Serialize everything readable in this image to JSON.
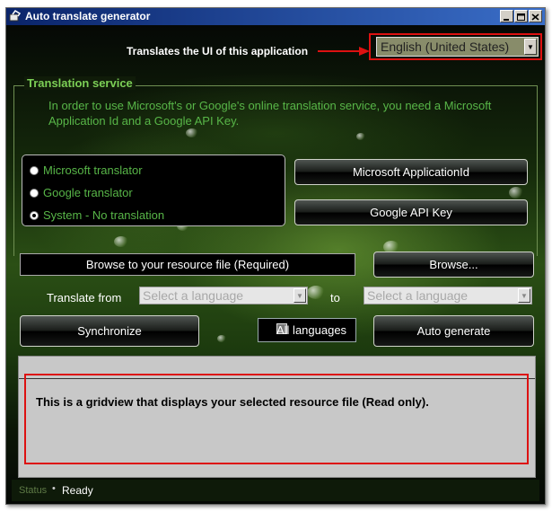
{
  "window": {
    "title": "Auto translate generator"
  },
  "ui_language": {
    "caption": "Translates the UI of this application",
    "selected": "English (United States)"
  },
  "translation_service": {
    "legend": "Translation service",
    "description": "In order to use Microsoft's or Google's online translation service, you need a Microsoft Application Id and a Google API Key.",
    "options": [
      {
        "label": "Microsoft translator",
        "selected": false
      },
      {
        "label": "Google translator",
        "selected": false
      },
      {
        "label": "System - No translation",
        "selected": true
      }
    ],
    "microsoft_button": "Microsoft ApplicationId",
    "google_button": "Google API Key"
  },
  "resource": {
    "browse_caption": "Browse to your resource file (Required)",
    "browse_button": "Browse..."
  },
  "languages": {
    "from_label": "Translate from",
    "from_placeholder": "Select a language",
    "to_label": "to",
    "to_placeholder": "Select a language"
  },
  "actions": {
    "synchronize": "Synchronize",
    "all_languages": "All languages",
    "all_languages_checked": false,
    "auto_generate": "Auto generate"
  },
  "grid": {
    "annotation": "This is a gridview that displays your selected resource file (Read only)."
  },
  "status": {
    "label": "Status",
    "text": "Ready"
  },
  "colors": {
    "annotation_red": "#dd1111",
    "accent_green": "#58b648"
  }
}
